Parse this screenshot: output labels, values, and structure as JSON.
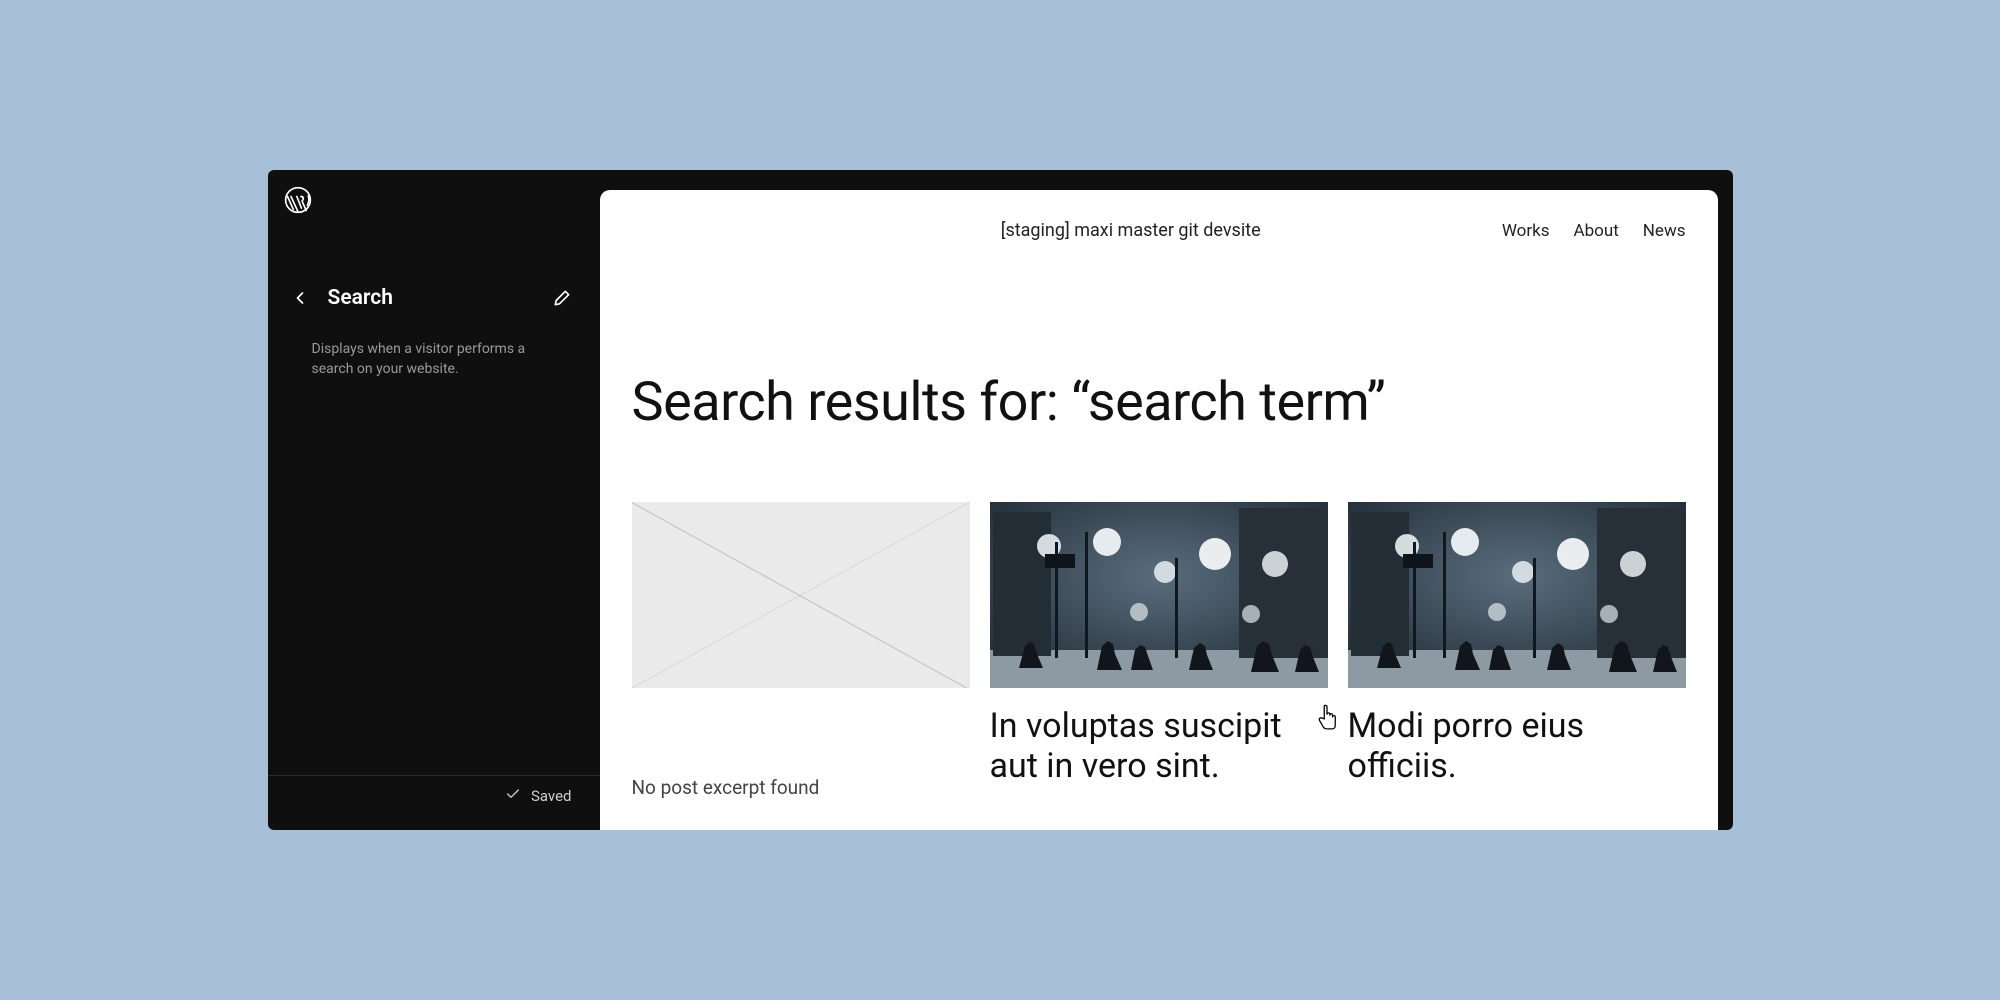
{
  "sidebar": {
    "title": "Search",
    "description": "Displays when a visitor performs a search on your website.",
    "saved_label": "Saved"
  },
  "preview": {
    "site_title": "[staging] maxi master git devsite",
    "nav": [
      "Works",
      "About",
      "News"
    ],
    "page_title": "Search results for: “search term”",
    "results": [
      {
        "has_image": false,
        "title": "",
        "excerpt": "No post excerpt found"
      },
      {
        "has_image": true,
        "title": "In voluptas suscipit aut in vero sint."
      },
      {
        "has_image": true,
        "title": "Modi porro eius officiis."
      }
    ]
  }
}
